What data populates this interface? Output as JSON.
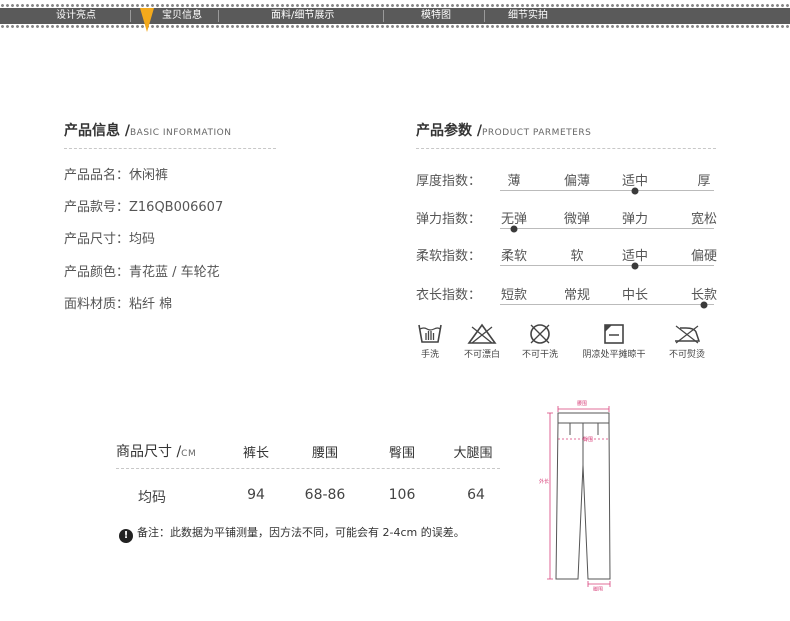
{
  "nav": {
    "items": [
      "设计亮点",
      "宝贝信息",
      "面料/细节展示",
      "模特图",
      "细节实拍"
    ],
    "active": "宝贝信息",
    "marker_color": "#f3a91c"
  },
  "basic_info": {
    "title_cn": "产品信息 /",
    "title_en": "BASIC INFORMATION",
    "lines": [
      "产品品名：休闲裤",
      "产品款号：Z16QB006607",
      "产品尺寸：均码",
      "产品颜色：青花蓝 / 车轮花",
      "面料材质：粘纤  棉"
    ]
  },
  "params": {
    "title_cn": "产品参数 /",
    "title_en": "PRODUCT PARMETERS",
    "rows": [
      {
        "label": "厚度指数：",
        "options": [
          "薄",
          "偏薄",
          "适中",
          "厚"
        ],
        "selected": 2
      },
      {
        "label": "弹力指数：",
        "options": [
          "无弹",
          "微弹",
          "弹力",
          "宽松"
        ],
        "selected": 0
      },
      {
        "label": "柔软指数：",
        "options": [
          "柔软",
          "软",
          "适中",
          "偏硬"
        ],
        "selected": 2
      },
      {
        "label": "衣长指数：",
        "options": [
          "短款",
          "常规",
          "中长",
          "长款"
        ],
        "selected": 3
      }
    ]
  },
  "care": [
    {
      "icon": "hand-wash-icon",
      "label": "手洗"
    },
    {
      "icon": "no-bleach-icon",
      "label": "不可漂白"
    },
    {
      "icon": "no-dry-clean-icon",
      "label": "不可干洗"
    },
    {
      "icon": "shade-flat-dry-icon",
      "label": "阴凉处平摊晾干"
    },
    {
      "icon": "no-iron-icon",
      "label": "不可熨烫"
    }
  ],
  "size_table": {
    "title_cn": "商品尺寸 /",
    "title_unit": "CM",
    "headers": [
      "裤长",
      "腰围",
      "臀围",
      "大腿围"
    ],
    "rows": [
      {
        "size": "均码",
        "values": [
          "94",
          "68-86",
          "106",
          "64"
        ]
      }
    ]
  },
  "note": "备注：此数据为平铺测量，因方法不同，可能会有 2-4cm 的误差。",
  "diagram": {
    "labels": [
      "腰围",
      "臀围",
      "外长",
      "脚围"
    ],
    "accent": "#d8407a"
  }
}
